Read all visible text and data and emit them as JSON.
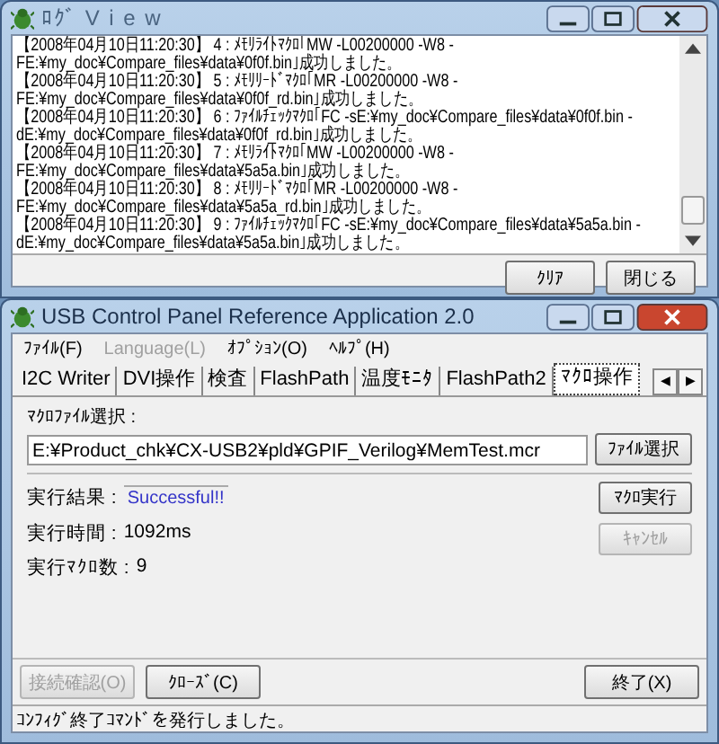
{
  "log_window": {
    "title": "ﾛｸﾞ V i e w",
    "lines": [
      "【2008年04月10日11:20:30】 4 : ﾒﾓﾘﾗｲﾄﾏｸﾛ｢MW -L00200000 -W8 -",
      "FE:¥my_doc¥Compare_files¥data¥0f0f.bin｣成功しました。",
      "【2008年04月10日11:20:30】 5 : ﾒﾓﾘﾘｰﾄﾞﾏｸﾛ｢MR -L00200000 -W8 -",
      "FE:¥my_doc¥Compare_files¥data¥0f0f_rd.bin｣成功しました。",
      "【2008年04月10日11:20:30】 6 : ﾌｧｲﾙﾁｪｯｸﾏｸﾛ｢FC -sE:¥my_doc¥Compare_files¥data¥0f0f.bin -",
      "dE:¥my_doc¥Compare_files¥data¥0f0f_rd.bin｣成功しました。",
      "【2008年04月10日11:20:30】 7 : ﾒﾓﾘﾗｲﾄﾏｸﾛ｢MW -L00200000 -W8 -",
      "FE:¥my_doc¥Compare_files¥data¥5a5a.bin｣成功しました。",
      "【2008年04月10日11:20:30】 8 : ﾒﾓﾘﾘｰﾄﾞﾏｸﾛ｢MR -L00200000 -W8 -",
      "FE:¥my_doc¥Compare_files¥data¥5a5a_rd.bin｣成功しました。",
      "【2008年04月10日11:20:30】 9 : ﾌｧｲﾙﾁｪｯｸﾏｸﾛ｢FC -sE:¥my_doc¥Compare_files¥data¥5a5a.bin -",
      "dE:¥my_doc¥Compare_files¥data¥5a5a.bin｣成功しました。"
    ],
    "buttons": [
      "ｸﾘｱ",
      "閉じる"
    ]
  },
  "main_window": {
    "title": "USB Control Panel Reference Application 2.0",
    "menu": [
      {
        "label": "ﾌｧｲﾙ(F)",
        "disabled": false
      },
      {
        "label": "Language(L)",
        "disabled": true
      },
      {
        "label": "ｵﾌﾟｼｮﾝ(O)",
        "disabled": false
      },
      {
        "label": "ﾍﾙﾌﾟ(H)",
        "disabled": false
      }
    ],
    "tabs": [
      {
        "label": "I2C Writer",
        "selected": false
      },
      {
        "label": "DVI操作",
        "selected": false
      },
      {
        "label": "検査",
        "selected": false
      },
      {
        "label": "FlashPath",
        "selected": false
      },
      {
        "label": "温度ﾓﾆﾀ",
        "selected": false
      },
      {
        "label": "FlashPath2",
        "selected": false
      },
      {
        "label": "ﾏｸﾛ操作",
        "selected": true
      }
    ],
    "tab_scroll": [
      "◀",
      "▶"
    ],
    "macro_file_label": "ﾏｸﾛﾌｧｲﾙ選択 :",
    "macro_file_path": "E:¥Product_chk¥CX-USB2¥pld¥GPIF_Verilog¥MemTest.mcr",
    "file_select_button": "ﾌｧｲﾙ選択",
    "results": [
      {
        "label": "実行結果 :",
        "value": "Successful!!",
        "kind": "status"
      },
      {
        "label": "実行時間 :",
        "value": "1092ms",
        "kind": "plain"
      },
      {
        "label": "実行ﾏｸﾛ数 :",
        "value": "9",
        "kind": "plain"
      }
    ],
    "side_buttons": [
      {
        "label": "ﾏｸﾛ実行",
        "disabled": false
      },
      {
        "label": "ｷｬﾝｾﾙ",
        "disabled": true
      }
    ],
    "bottom_buttons": [
      {
        "label": "接続確認(O)",
        "disabled": true
      },
      {
        "label": "ｸﾛｰｽﾞ(C)",
        "disabled": false
      },
      {
        "label": "終了(X)",
        "disabled": false
      }
    ],
    "status_bar": "ｺﾝﾌｨｸﾞ終了ｺﾏﾝﾄﾞを発行しました。"
  }
}
